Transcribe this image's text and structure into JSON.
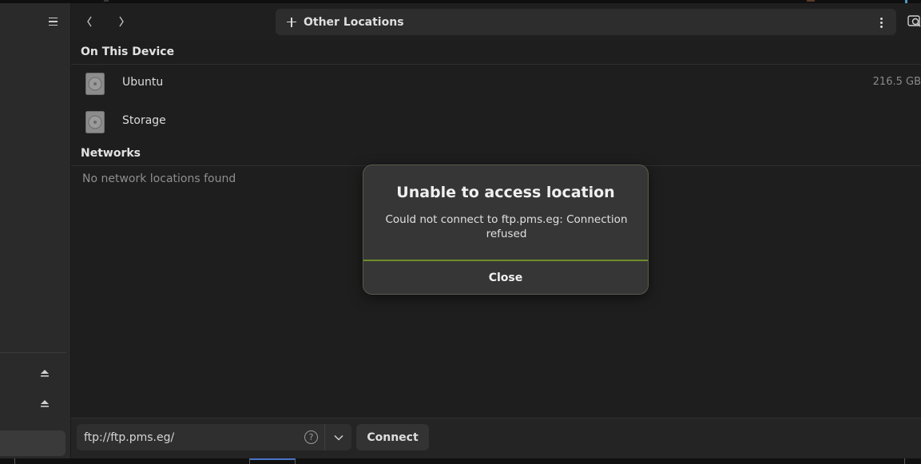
{
  "header": {
    "path_label": "Other Locations"
  },
  "sections": {
    "device_title": "On This Device",
    "networks_title": "Networks",
    "no_networks": "No network locations found"
  },
  "devices": [
    {
      "label": "Ubuntu",
      "size": "216.5 GB",
      "icon": "drive-harddisk-icon"
    },
    {
      "label": "Storage",
      "size": "",
      "icon": "drive-harddisk-icon"
    }
  ],
  "bottombar": {
    "address_value": "ftp://ftp.pms.eg/",
    "help_glyph": "?",
    "connect_label": "Connect"
  },
  "dialog": {
    "title": "Unable to access location",
    "message": "Could not connect to ftp.pms.eg: Connection refused",
    "close_label": "Close"
  },
  "colors": {
    "background": "#1e1e1e",
    "sidebar": "#2a2a2a",
    "dialog_bg": "#363636",
    "accent_separator": "#6f8d28"
  }
}
